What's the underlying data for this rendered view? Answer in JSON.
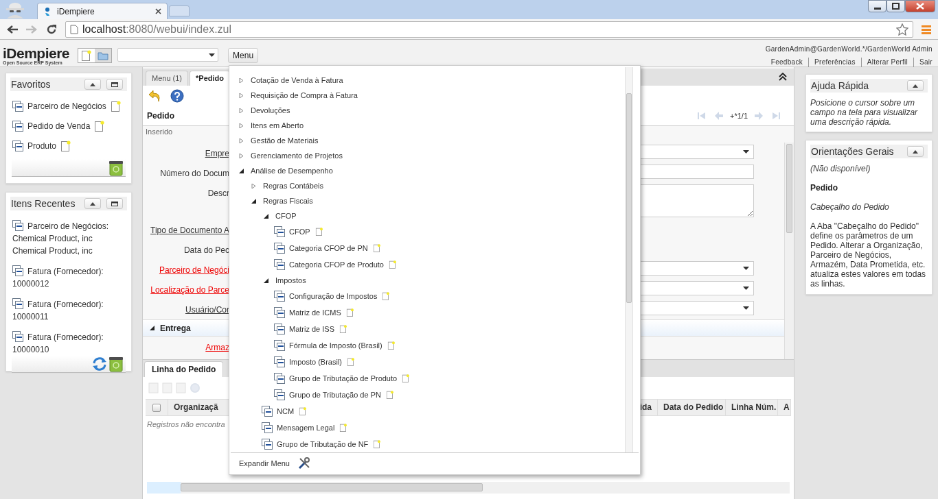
{
  "browser": {
    "tab_title": "iDempiere",
    "url_host": "localhost",
    "url_rest": ":8080/webui/index.zul"
  },
  "header": {
    "logo": "iDempiere",
    "tagline": "Open Source ERP System",
    "menu_button": "Menu",
    "user": "GardenAdmin@GardenWorld.*/GardenWorld Admin",
    "links": [
      "Feedback",
      "Preferências",
      "Alterar Perfil",
      "Sair"
    ]
  },
  "favorites": {
    "title": "Favoritos",
    "items": [
      {
        "label": "Parceiro de Negócios"
      },
      {
        "label": "Pedido de Venda"
      },
      {
        "label": "Produto"
      }
    ]
  },
  "recent": {
    "title": "Itens Recentes",
    "items": [
      {
        "label": "Parceiro de Negócios: Chemical Product, inc Chemical Product, inc"
      },
      {
        "label": "Fatura (Fornecedor): 10000012"
      },
      {
        "label": "Fatura (Fornecedor): 10000011"
      },
      {
        "label": "Fatura (Fornecedor): 10000010"
      }
    ]
  },
  "window_tabs": [
    {
      "label": "Menu (1)",
      "selected": false
    },
    {
      "label": "*Pedido",
      "selected": true
    }
  ],
  "form": {
    "title": "Pedido",
    "record_nav": "+*1/1",
    "status": "Inserido",
    "fields": [
      {
        "label": "Empre",
        "zoomable": true,
        "mandatory": false,
        "kind": "select"
      },
      {
        "label": "Número do Docum",
        "zoomable": false,
        "mandatory": false,
        "kind": "text"
      },
      {
        "label": "Descr",
        "zoomable": false,
        "mandatory": false,
        "kind": "textarea"
      },
      {
        "label": "Tipo de Documento A",
        "zoomable": true,
        "mandatory": false,
        "kind": "covered"
      },
      {
        "label": "Data do Pec",
        "zoomable": false,
        "mandatory": false,
        "kind": "covered"
      },
      {
        "label": "Parceiro de Negóci",
        "zoomable": true,
        "mandatory": true,
        "kind": "select"
      },
      {
        "label": "Localização do Parce",
        "zoomable": true,
        "mandatory": true,
        "kind": "select"
      },
      {
        "label": "Usuário/Cor",
        "zoomable": true,
        "mandatory": false,
        "kind": "select"
      }
    ],
    "section": {
      "title": "Entrega",
      "expanded": true
    },
    "section_fields": [
      {
        "label": "Armaz",
        "zoomable": true,
        "mandatory": true
      }
    ]
  },
  "detail": {
    "tab": "Linha do Pedido",
    "select_all": {
      "checked": false
    },
    "columns": [
      "Organizaçã",
      "ida",
      "Data do Pedido",
      "Linha Núm.",
      "A"
    ],
    "empty_text": "Registros não encontra"
  },
  "menu_tree": {
    "items": [
      {
        "label": "Cotação de Venda à Fatura",
        "kind": "folder",
        "expanded": false
      },
      {
        "label": "Requisição de Compra à Fatura",
        "kind": "folder",
        "expanded": false
      },
      {
        "label": "Devoluções",
        "kind": "folder",
        "expanded": false
      },
      {
        "label": "Itens em Aberto",
        "kind": "folder",
        "expanded": false
      },
      {
        "label": "Gestão de Materiais",
        "kind": "folder",
        "expanded": false
      },
      {
        "label": "Gerenciamento de Projetos",
        "kind": "folder",
        "expanded": false
      },
      {
        "label": "Análise de Desempenho",
        "kind": "folder",
        "expanded": true,
        "children": [
          {
            "label": "Regras Contábeis",
            "kind": "folder",
            "expanded": false
          },
          {
            "label": "Regras Fiscais",
            "kind": "folder",
            "expanded": true,
            "children": [
              {
                "label": "CFOP",
                "kind": "folder",
                "expanded": true,
                "children": [
                  {
                    "label": "CFOP",
                    "kind": "window"
                  },
                  {
                    "label": "Categoria CFOP de PN",
                    "kind": "window"
                  },
                  {
                    "label": "Categoria CFOP de Produto",
                    "kind": "window"
                  }
                ]
              },
              {
                "label": "Impostos",
                "kind": "folder",
                "expanded": true,
                "children": [
                  {
                    "label": "Configuração de Impostos",
                    "kind": "window"
                  },
                  {
                    "label": "Matriz de ICMS",
                    "kind": "window"
                  },
                  {
                    "label": "Matriz de ISS",
                    "kind": "window"
                  },
                  {
                    "label": "Fórmula de Imposto (Brasil)",
                    "kind": "window"
                  },
                  {
                    "label": "Imposto (Brasil)",
                    "kind": "window"
                  },
                  {
                    "label": "Grupo de Tributação de Produto",
                    "kind": "window"
                  },
                  {
                    "label": "Grupo de Tributação de PN",
                    "kind": "window"
                  }
                ]
              },
              {
                "label": "NCM",
                "kind": "window"
              },
              {
                "label": "Mensagem Legal",
                "kind": "window"
              },
              {
                "label": "Grupo de Tributação de NF",
                "kind": "window"
              }
            ]
          }
        ]
      }
    ],
    "footer": "Expandir Menu"
  },
  "quick_help": {
    "title": "Ajuda Rápida",
    "text": "Posicione o cursor sobre um campo na tela para visualizar uma descrição rápida."
  },
  "guidelines": {
    "title": "Orientações Gerais",
    "availability": "(Não disponível)",
    "heading": "Pedido",
    "subheading": "Cabeçalho do Pedido",
    "text": "A Aba \"Cabeçalho do Pedido\" define os parâmetros de um Pedido. Alterar a Organização, Parceiro de Negócios, Armazém, Data Prometida, etc. atualiza estes valores em todas as linhas."
  }
}
